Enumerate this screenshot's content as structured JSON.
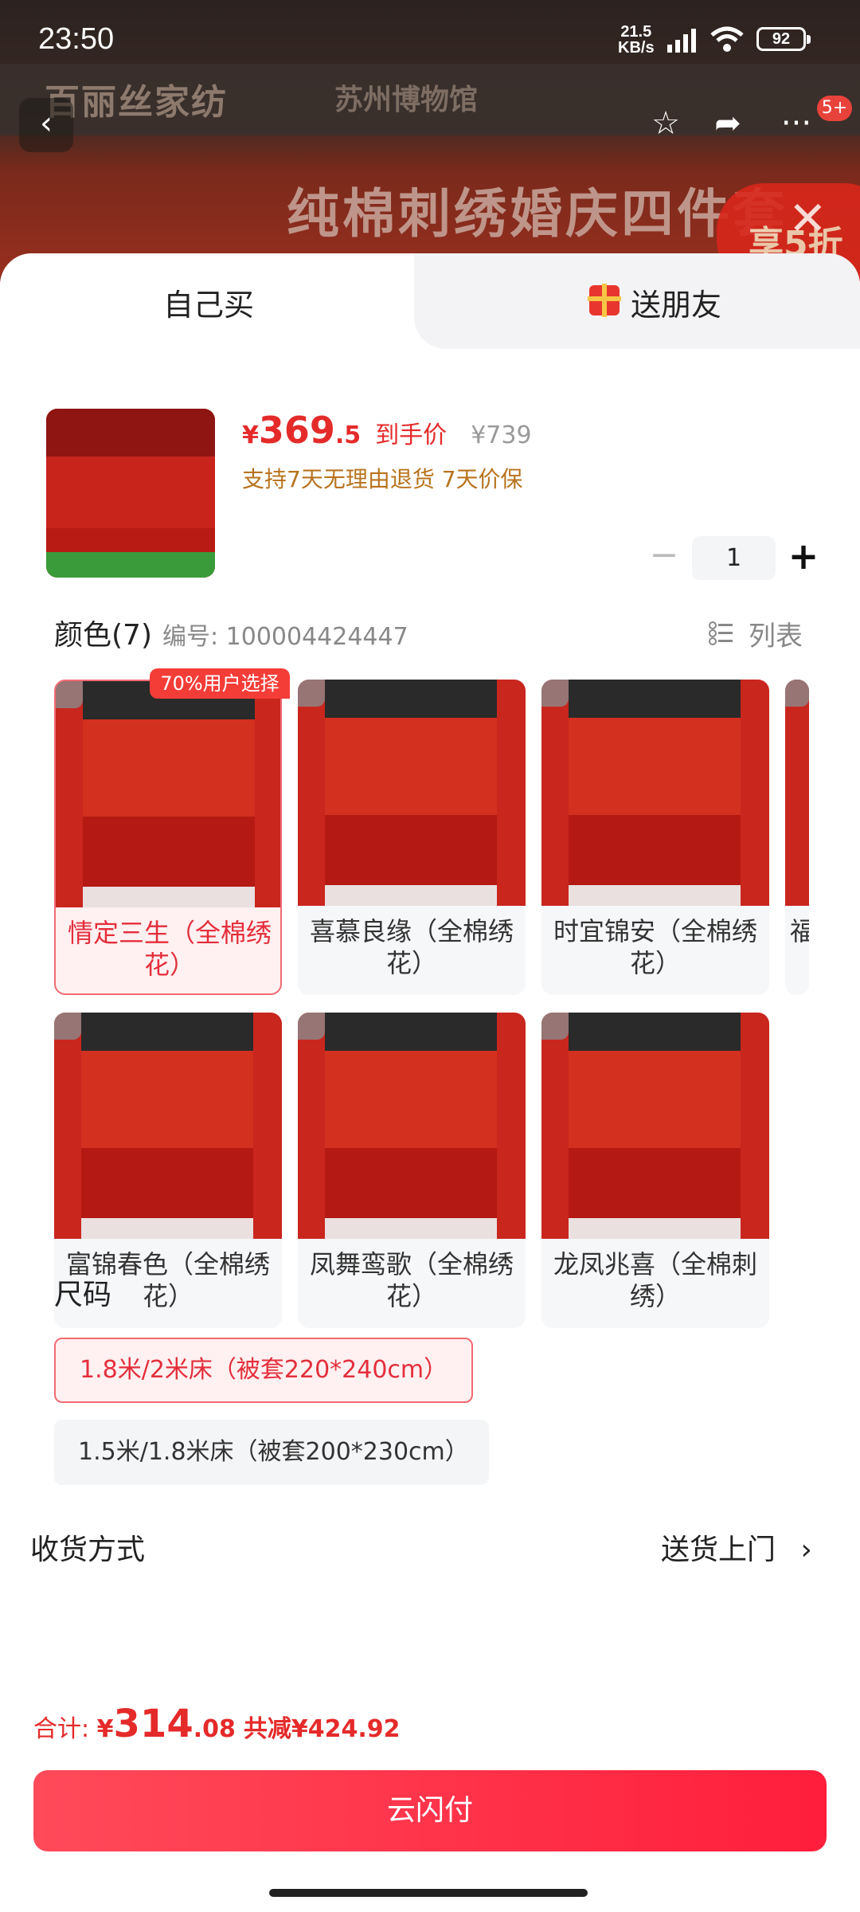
{
  "status_bar": {
    "time": "23:50",
    "net_speed": "21.5",
    "net_unit": "KB/s",
    "battery": "92"
  },
  "banner": {
    "brand_left": "百丽丝家纺",
    "brand_right": "苏州博物馆",
    "title": "纯棉刺绣婚庆四件套",
    "promo": "享5折",
    "notification_count": "5+"
  },
  "tabs": [
    {
      "label": "自己买"
    },
    {
      "label": "送朋友"
    }
  ],
  "product": {
    "currency": "¥",
    "price_int": "369",
    "price_dec": ".5",
    "price_note": "到手价",
    "original_price": "¥739",
    "guarantee": "支持7天无理由退货  7天价保",
    "quantity": "1",
    "minus": "−",
    "plus": "+"
  },
  "colors": {
    "heading": "颜色(7)",
    "sku": "编号: 100004424447",
    "list_view_label": "列表",
    "popular_tag": "70%用户选择",
    "options": [
      {
        "label": "情定三生（全棉绣花）",
        "selected": true
      },
      {
        "label": "喜慕良缘（全棉绣花）",
        "selected": false
      },
      {
        "label": "时宜锦安（全棉绣花）",
        "selected": false
      },
      {
        "label": "福",
        "selected": false
      },
      {
        "label": "富锦春色（全棉绣花）",
        "selected": false
      },
      {
        "label": "凤舞鸾歌（全棉绣花）",
        "selected": false
      },
      {
        "label": "龙凤兆喜（全棉刺绣）",
        "selected": false
      }
    ]
  },
  "sizes": {
    "heading": "尺码",
    "options": [
      {
        "label": "1.8米/2米床（被套220*240cm）",
        "selected": true
      },
      {
        "label": "1.5米/1.8米床（被套200*230cm）",
        "selected": false
      }
    ]
  },
  "delivery": {
    "label": "收货方式",
    "value": "送货上门",
    "chevron": "›"
  },
  "footer": {
    "total_label": "合计: ",
    "currency": "¥",
    "total_int": "314",
    "total_dec": ".08",
    "savings": "共减¥424.92",
    "pay_button": "云闪付"
  },
  "icons": [
    "back-icon",
    "star-icon",
    "share-icon",
    "more-icon",
    "close-icon",
    "gift-icon",
    "list-view-icon",
    "expand-corner-icon",
    "wifi-icon",
    "signal-icon"
  ],
  "colors_theme": {
    "accent": "#e52a2a",
    "pay_button": "#ff2740",
    "guarantee": "#b8731d"
  }
}
